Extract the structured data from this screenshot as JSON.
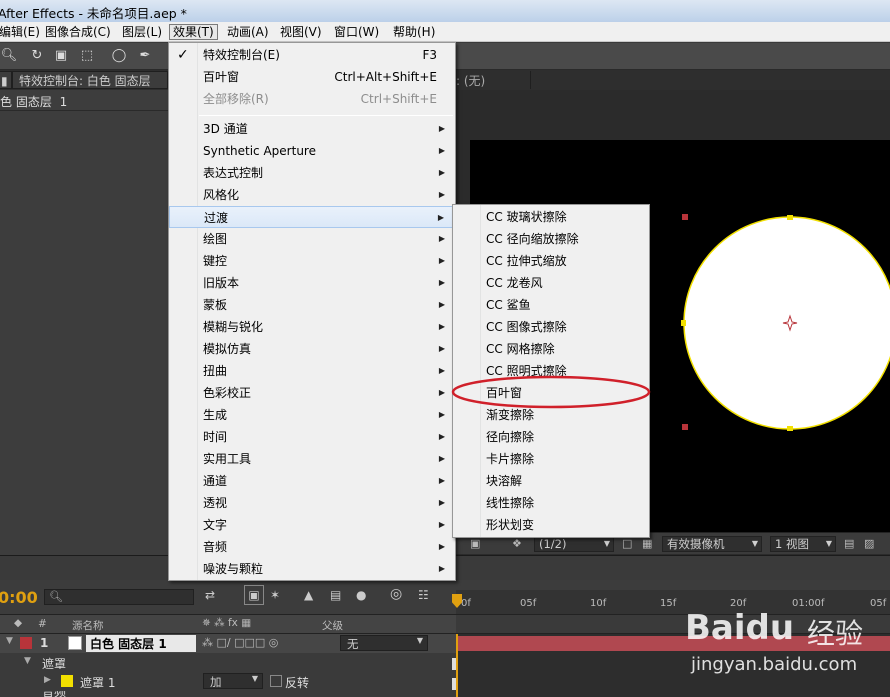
{
  "window": {
    "title": "After Effects - 未命名项目.aep *"
  },
  "menubar": [
    {
      "label": "编辑(E)"
    },
    {
      "label": "图像合成(C)"
    },
    {
      "label": "图层(L)"
    },
    {
      "label": "效果(T)",
      "active": true
    },
    {
      "label": "动画(A)"
    },
    {
      "label": "视图(V)"
    },
    {
      "label": "窗口(W)"
    },
    {
      "label": "帮助(H)"
    }
  ],
  "panels": {
    "effect_controls_tab": "特效控制台: 白色 固态层",
    "effect_controls_tab_num": "1",
    "layer_path": "色 固态层",
    "layer_path_num": "1",
    "comp_tab_suffix": ": (无)"
  },
  "effect_menu": {
    "items": [
      {
        "label": "特效控制台(E)",
        "shortcut": "F3",
        "checked": true
      },
      {
        "label": "百叶窗",
        "shortcut": "Ctrl+Alt+Shift+E"
      },
      {
        "label": "全部移除(R)",
        "shortcut": "Ctrl+Shift+E",
        "disabled": true
      },
      {
        "label": "3D 通道",
        "submenu": true
      },
      {
        "label": "Synthetic Aperture",
        "submenu": true
      },
      {
        "label": "表达式控制",
        "submenu": true
      },
      {
        "label": "风格化",
        "submenu": true
      },
      {
        "label": "过渡",
        "submenu": true,
        "highlighted": true
      },
      {
        "label": "绘图",
        "submenu": true
      },
      {
        "label": "键控",
        "submenu": true
      },
      {
        "label": "旧版本",
        "submenu": true
      },
      {
        "label": "蒙板",
        "submenu": true
      },
      {
        "label": "模糊与锐化",
        "submenu": true
      },
      {
        "label": "模拟仿真",
        "submenu": true
      },
      {
        "label": "扭曲",
        "submenu": true
      },
      {
        "label": "色彩校正",
        "submenu": true
      },
      {
        "label": "生成",
        "submenu": true
      },
      {
        "label": "时间",
        "submenu": true
      },
      {
        "label": "实用工具",
        "submenu": true
      },
      {
        "label": "通道",
        "submenu": true
      },
      {
        "label": "透视",
        "submenu": true
      },
      {
        "label": "文字",
        "submenu": true
      },
      {
        "label": "音频",
        "submenu": true
      },
      {
        "label": "噪波与颗粒",
        "submenu": true
      }
    ]
  },
  "transition_submenu": {
    "items": [
      {
        "label": "CC 玻璃状擦除"
      },
      {
        "label": "CC 径向缩放擦除"
      },
      {
        "label": "CC 拉伸式缩放"
      },
      {
        "label": "CC 龙卷风"
      },
      {
        "label": "CC 鲨鱼"
      },
      {
        "label": "CC 图像式擦除"
      },
      {
        "label": "CC 网格擦除"
      },
      {
        "label": "CC 照明式擦除"
      },
      {
        "label": "百叶窗",
        "circled": true
      },
      {
        "label": "渐变擦除"
      },
      {
        "label": "径向擦除"
      },
      {
        "label": "卡片擦除"
      },
      {
        "label": "块溶解"
      },
      {
        "label": "线性擦除"
      },
      {
        "label": "形状划变"
      }
    ]
  },
  "viewer": {
    "resolution": "(1/2)",
    "camera": "有效摄像机",
    "views": "1 视图"
  },
  "timeline": {
    "timecode": "0:00",
    "header": {
      "num": "#",
      "source": "源名称",
      "parent": "父级"
    },
    "ruler_ticks": [
      "0f",
      "05f",
      "10f",
      "15f",
      "20f",
      "01:00f",
      "05f"
    ],
    "layer": {
      "index": "1",
      "name": "白色 固态层 1",
      "parent": "无"
    },
    "mask_group": "遮罩",
    "mask": {
      "name": "遮罩 1",
      "mode": "加",
      "invert_label": "反转"
    },
    "next_row": "音频"
  },
  "watermark": {
    "brand": "Baidu",
    "brand_cn": "经验",
    "url": "jingyan.baidu.com"
  },
  "colors": {
    "menu_highlight": "#dbe8f8",
    "annotation_red": "#d0202a",
    "mask_yellow": "#f2e000",
    "layer_red": "#b8343a",
    "track_bar": "#b04850"
  }
}
